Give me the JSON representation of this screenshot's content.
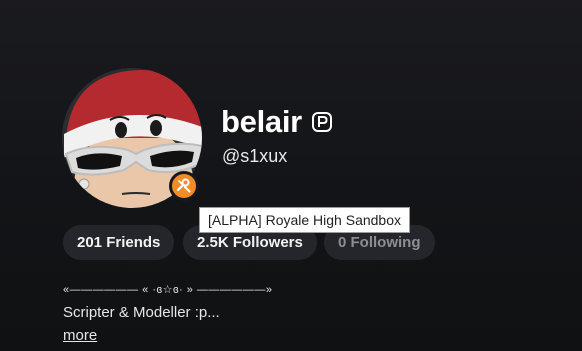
{
  "profile": {
    "display_name": "belair",
    "username": "@s1xux",
    "premium_icon": "premium-icon",
    "presence_icon": "studio-tools-icon",
    "presence_color": "#f28c28"
  },
  "tooltip": {
    "text": "[ALPHA] Royale High Sandbox"
  },
  "stats": {
    "friends": "201 Friends",
    "followers": "2.5K Followers",
    "following": "0 Following"
  },
  "bio": {
    "decoration": "«—————— « ·ɞ☆ɞ· » ——————»",
    "text": "Scripter & Modeller :p...",
    "more_label": "more"
  }
}
